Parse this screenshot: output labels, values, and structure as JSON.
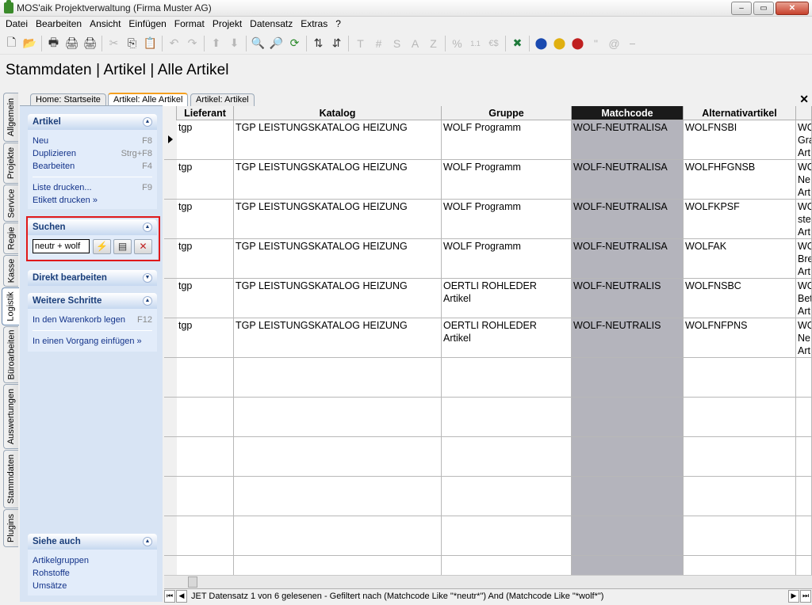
{
  "window": {
    "title": "MOS'aik Projektverwaltung (Firma Muster AG)",
    "btn_min": "–",
    "btn_max": "▭",
    "btn_close": "✕"
  },
  "menu": [
    "Datei",
    "Bearbeiten",
    "Ansicht",
    "Einfügen",
    "Format",
    "Projekt",
    "Datensatz",
    "Extras",
    "?"
  ],
  "toolbar": {
    "icons": [
      "new-file-icon",
      "open-folder-icon",
      "print-icon",
      "print-preview-icon",
      "print-setup-icon",
      "cut-icon",
      "copy-icon",
      "paste-icon",
      "undo-icon",
      "redo-icon",
      "move-up-icon",
      "move-down-icon",
      "find-icon",
      "find-next-icon",
      "refresh-icon",
      "sort-asc-icon",
      "sort-desc-icon"
    ],
    "glyphs": [
      "🗋",
      "📂",
      "🖶",
      "🖨",
      "🖨",
      "✂",
      "⎘",
      "📋",
      "↶",
      "↷",
      "⬆",
      "⬇",
      "🔍",
      "🔎",
      "⟳",
      "⇅",
      "⇵"
    ],
    "format_glyphs": [
      "T",
      "#",
      "S",
      "A",
      "Z",
      "%",
      "1.1",
      "€$"
    ],
    "extra_glyphs": [
      "✖",
      "⬤",
      "⬤",
      "⬤",
      "\"",
      "@",
      "⎯"
    ]
  },
  "page_title": "Stammdaten | Artikel | Alle Artikel",
  "vertical_tabs": [
    "Allgemein",
    "Projekte",
    "Service",
    "Regie",
    "Kasse",
    "Logistik",
    "Büroarbeiten",
    "Auswertungen",
    "Stammdaten",
    "Plugins"
  ],
  "active_vtab": "Logistik",
  "doc_tabs": [
    "Home: Startseite",
    "Artikel: Alle Artikel",
    "Artikel: Artikel"
  ],
  "doc_close": "✕",
  "panel": {
    "artikel": {
      "title": "Artikel",
      "items": [
        {
          "label": "Neu",
          "key": "F8"
        },
        {
          "label": "Duplizieren",
          "key": "Strg+F8"
        },
        {
          "label": "Bearbeiten",
          "key": "F4"
        },
        {
          "label": "Liste drucken...",
          "key": "F9"
        },
        {
          "label": "Etikett drucken »",
          "key": ""
        }
      ]
    },
    "suchen": {
      "title": "Suchen",
      "value": "neutr + wolf"
    },
    "direkt": {
      "title": "Direkt bearbeiten"
    },
    "weitere": {
      "title": "Weitere Schritte",
      "items": [
        {
          "label": "In den Warenkorb legen",
          "key": "F12"
        },
        {
          "label": "In einen Vorgang einfügen »",
          "key": ""
        }
      ]
    },
    "siehe": {
      "title": "Siehe auch",
      "items": [
        "Artikelgruppen",
        "Rohstoffe",
        "Umsätze"
      ]
    }
  },
  "grid": {
    "columns": [
      "Lieferant",
      "Katalog",
      "Gruppe",
      "Matchcode",
      "Alternativartikel",
      ""
    ],
    "rows": [
      [
        "tgp",
        "TGP LEISTUNGSKATALOG  HEIZUNG",
        "WOLF Programm",
        "WOLF-NEUTRALISA",
        "WOLFNSBI",
        "WO\nGra\nArt"
      ],
      [
        "tgp",
        "TGP LEISTUNGSKATALOG  HEIZUNG",
        "WOLF Programm",
        "WOLF-NEUTRALISA",
        "WOLFHFGNSB",
        "WO\nNe\nArt"
      ],
      [
        "tgp",
        "TGP LEISTUNGSKATALOG  HEIZUNG",
        "WOLF Programm",
        "WOLF-NEUTRALISA",
        "WOLFKPSF",
        "WO\nste\nArt"
      ],
      [
        "tgp",
        "TGP LEISTUNGSKATALOG  HEIZUNG",
        "WOLF Programm",
        "WOLF-NEUTRALISA",
        "WOLFAK",
        "WO\nBre\nArt"
      ],
      [
        "tgp",
        "TGP LEISTUNGSKATALOG  HEIZUNG",
        "OERTLI ROHLEDER\nArtikel",
        "WOLF-NEUTRALIS",
        "WOLFNSBC",
        "WO\nBet\nArt"
      ],
      [
        "tgp",
        "TGP LEISTUNGSKATALOG  HEIZUNG",
        "OERTLI ROHLEDER\nArtikel",
        "WOLF-NEUTRALIS",
        "WOLFNFPNS",
        "WO\nNe\nArt"
      ]
    ]
  },
  "status": {
    "text": "JET Datensatz 1 von 6 gelesenen - Gefiltert nach (Matchcode Like \"*neutr*\") And (Matchcode Like \"*wolf*\")",
    "nav": [
      "⏮",
      "◀",
      "▶",
      "⏭"
    ]
  }
}
